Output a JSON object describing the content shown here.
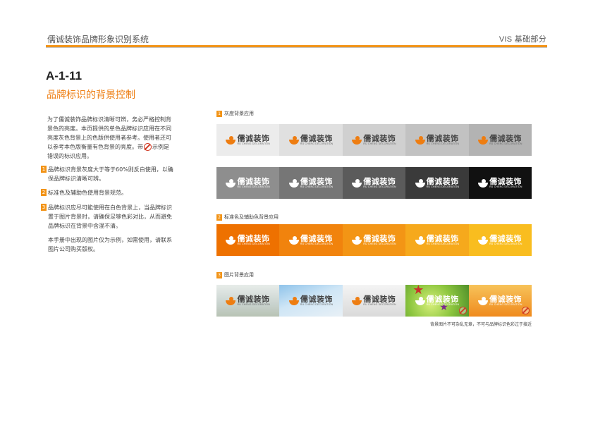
{
  "header": {
    "title": "儒诚装饰品牌形象识别系统",
    "section": "VIS 基础部分",
    "accent": "#f29418"
  },
  "page": {
    "code": "A-1-11",
    "subtitle": "品牌标识的背景控制"
  },
  "intro": {
    "before_sign": "为了儒诚装饰品牌标识清晰可辨，务必严格控制背景色的亮度。本页提供的单色品牌标识应用在不同亮度灰色背景上的色版供使用者参考。使用者还可以参考本色版衡量有色背景的亮度。带",
    "after_sign": "示例是错误的标识应用。",
    "sign_icon": "prohibited-icon"
  },
  "notes": [
    {
      "num": "1",
      "text": "品牌标识背景灰度大于等于60%则反白使用，以确保品牌标识清晰可辨。"
    },
    {
      "num": "2",
      "text": "标准色及辅助色使用背景规范。"
    },
    {
      "num": "3",
      "text": "品牌标识应尽可能使用在白色背景上，当品牌标识置于图片背景时，请确保足够色彩对比，从而避免品牌标识在背景中含混不清。"
    },
    {
      "num": "",
      "text": "本手册中出现的图片仅为示例，如需使用，请联系图片公司购买版权。"
    }
  ],
  "logo": {
    "name_cn": "儒诚装饰",
    "name_en": "RU CHENG DECORATION"
  },
  "sections": [
    {
      "num": "1",
      "label": "灰度背景应用",
      "rows": [
        {
          "tiles": [
            {
              "bg": "#ececec",
              "logo": "light"
            },
            {
              "bg": "#e0e0e0",
              "logo": "light"
            },
            {
              "bg": "#d0d0d0",
              "logo": "light"
            },
            {
              "bg": "#c2c2c2",
              "logo": "light"
            },
            {
              "bg": "#b3b3b3",
              "logo": "light"
            }
          ]
        },
        {
          "tiles": [
            {
              "bg": "#8e8e8e",
              "logo": "white"
            },
            {
              "bg": "#767676",
              "logo": "white"
            },
            {
              "bg": "#5b5b5b",
              "logo": "white"
            },
            {
              "bg": "#3a3a3a",
              "logo": "white"
            },
            {
              "bg": "#111111",
              "logo": "white"
            }
          ]
        }
      ]
    },
    {
      "num": "2",
      "label": "标准色及辅助色背景应用",
      "rows": [
        {
          "tiles": [
            {
              "bg": "#ee7100",
              "logo": "white"
            },
            {
              "bg": "#f1830d",
              "logo": "white"
            },
            {
              "bg": "#f39515",
              "logo": "white"
            },
            {
              "bg": "#f6a91c",
              "logo": "white"
            },
            {
              "bg": "#f9bd1f",
              "logo": "white"
            }
          ]
        }
      ]
    },
    {
      "num": "3",
      "label": "图片背景应用",
      "rows": [
        {
          "tiles": [
            {
              "bg": "photo-1",
              "logo": "light"
            },
            {
              "bg": "photo-2",
              "logo": "light"
            },
            {
              "bg": "photo-3",
              "logo": "light"
            },
            {
              "bg": "photo-4",
              "logo": "white",
              "prohibited": true
            },
            {
              "bg": "photo-5",
              "logo": "white",
              "prohibited": true
            }
          ]
        }
      ]
    }
  ],
  "caption": "背景图片不可杂乱无章，不可与品牌标识色彩过于接近"
}
